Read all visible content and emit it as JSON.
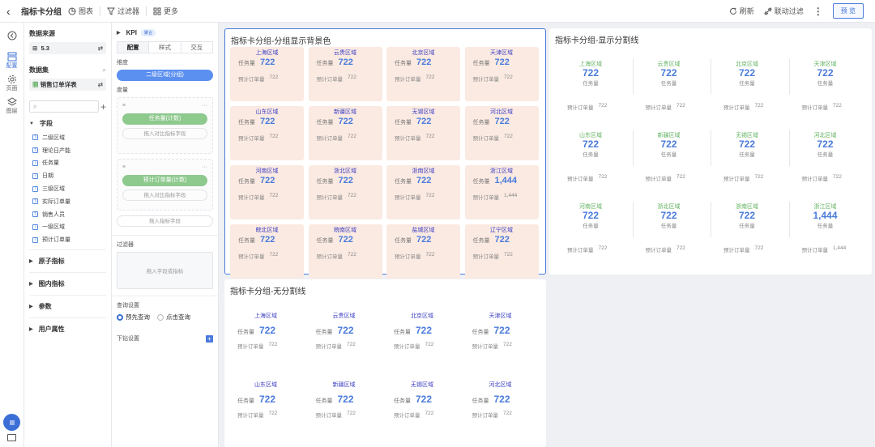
{
  "topbar": {
    "title": "指标卡分组",
    "chart": "图表",
    "filter": "过滤器",
    "more": "更多",
    "refresh": "刷新",
    "link_filter": "联动过滤",
    "preview": "预 览"
  },
  "rail": {
    "config": "配置",
    "page": "页面",
    "layer": "图层"
  },
  "datasource": {
    "title": "数据来源",
    "value": "5.3",
    "dataset_title": "数据集",
    "dataset": "销售订单详表",
    "search_placeholder": "",
    "fields_title": "字段",
    "fields": [
      "二级区域",
      "理论日产能",
      "任务量",
      "日期",
      "三级区域",
      "实际订单量",
      "销售人员",
      "一级区域",
      "预计订单量"
    ],
    "groups": [
      "原子指标",
      "图内指标",
      "参数",
      "用户属性"
    ]
  },
  "config": {
    "kpi": "KPI",
    "badge": "聚合",
    "tabs": [
      "配置",
      "样式",
      "交互"
    ],
    "dimension_label": "维度",
    "dimension_pill": "二级区域(分组)",
    "measure_label": "度量",
    "measure1": "任务量(计数)",
    "compare1": "拖入对比指标字段",
    "measure2": "预计订单量(计数)",
    "compare2": "拖入对比指标字段",
    "add_metric": "拖入指标字段",
    "filter_label": "过滤器",
    "filter_drop": "拖入字段或指标",
    "query_label": "查询设置",
    "query_opt1": "预先查询",
    "query_opt2": "点击查询",
    "drill_label": "下钻设置"
  },
  "card1": {
    "title": "指标卡分组-分组显示背景色"
  },
  "card2": {
    "title": "指标卡分组-显示分割线"
  },
  "card3": {
    "title": "指标卡分组-无分割线"
  },
  "kpi_labels": {
    "main": "任务量",
    "sub": "预计订单量"
  },
  "regions": [
    {
      "name": "上海区域",
      "main": "722",
      "sub": "722"
    },
    {
      "name": "云贵区域",
      "main": "722",
      "sub": "722"
    },
    {
      "name": "北京区域",
      "main": "722",
      "sub": "722"
    },
    {
      "name": "天津区域",
      "main": "722",
      "sub": "722"
    },
    {
      "name": "山东区域",
      "main": "722",
      "sub": "722"
    },
    {
      "name": "新疆区域",
      "main": "722",
      "sub": "722"
    },
    {
      "name": "无锡区域",
      "main": "722",
      "sub": "722"
    },
    {
      "name": "河北区域",
      "main": "722",
      "sub": "722"
    },
    {
      "name": "河南区域",
      "main": "722",
      "sub": "722"
    },
    {
      "name": "浙北区域",
      "main": "722",
      "sub": "722"
    },
    {
      "name": "浙南区域",
      "main": "722",
      "sub": "722"
    },
    {
      "name": "浙江区域",
      "main": "1,444",
      "sub": "1,444"
    },
    {
      "name": "皖北区域",
      "main": "722",
      "sub": "722"
    },
    {
      "name": "皖南区域",
      "main": "722",
      "sub": "722"
    },
    {
      "name": "盐城区域",
      "main": "722",
      "sub": "722"
    },
    {
      "name": "辽宁区域",
      "main": "722",
      "sub": "722"
    }
  ],
  "colors": {
    "accent": "#4a7bdc",
    "region_bg": "#fbeae2",
    "green": "#62b262"
  }
}
